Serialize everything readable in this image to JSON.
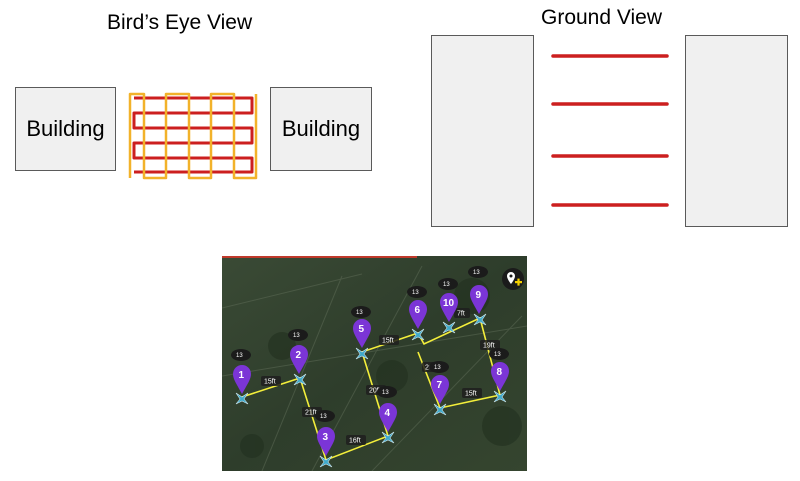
{
  "titles": {
    "birds_eye": "Bird’s Eye View",
    "ground": "Ground View"
  },
  "buildings": {
    "left": "Building",
    "right": "Building"
  },
  "colors": {
    "path_red": "#cc1f1f",
    "path_yellow": "#f2b22a",
    "building_fill": "#f0f0f0",
    "waypoint_purple": "#7b35d6",
    "route_yellow": "#f3ee3b"
  },
  "map": {
    "icon": "add-location-icon",
    "waypoints": [
      {
        "number": "1",
        "altitude": "13"
      },
      {
        "number": "2",
        "altitude": "13"
      },
      {
        "number": "3",
        "altitude": "13"
      },
      {
        "number": "4",
        "altitude": "13"
      },
      {
        "number": "5",
        "altitude": "13"
      },
      {
        "number": "6",
        "altitude": "13"
      },
      {
        "number": "7",
        "altitude": "13"
      },
      {
        "number": "8",
        "altitude": "13"
      },
      {
        "number": "9",
        "altitude": "13"
      },
      {
        "number": "10",
        "altitude": "13"
      }
    ],
    "segment_labels": [
      "15ft",
      "21ft",
      "16ft",
      "20ft",
      "15ft",
      "20ft",
      "15ft",
      "19ft",
      "7ft"
    ]
  }
}
